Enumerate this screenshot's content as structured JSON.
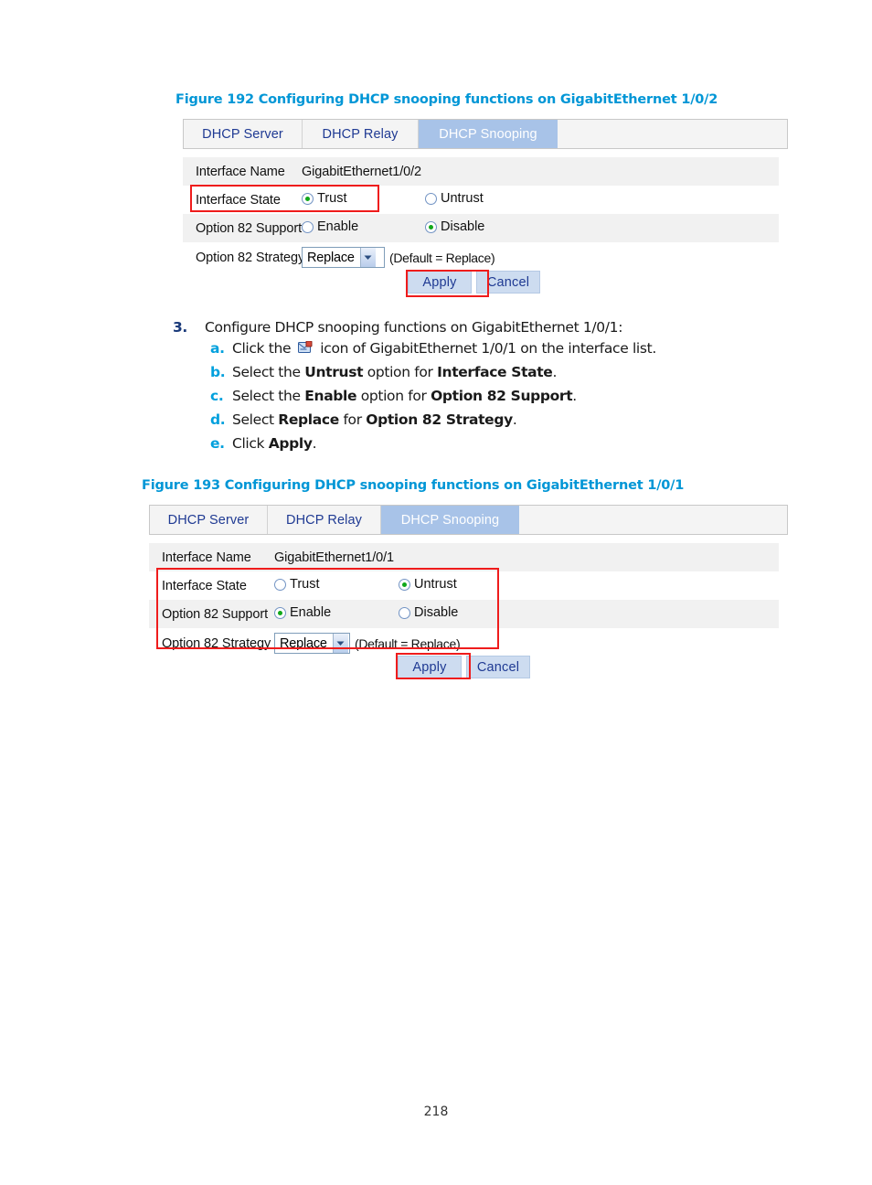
{
  "page": {
    "number": "218"
  },
  "figure192": {
    "caption": "Figure 192 Configuring DHCP snooping functions on GigabitEthernet 1/0/2",
    "tabs": [
      {
        "label": "DHCP Server",
        "active": false
      },
      {
        "label": "DHCP Relay",
        "active": false
      },
      {
        "label": "DHCP Snooping",
        "active": true
      }
    ],
    "rows": {
      "interface_name_label": "Interface Name",
      "interface_name_value": "GigabitEthernet1/0/2",
      "interface_state_label": "Interface State",
      "interface_state_trust": "Trust",
      "interface_state_untrust": "Untrust",
      "interface_state_selected": "Trust",
      "option82_support_label": "Option 82 Support",
      "option82_enable": "Enable",
      "option82_disable": "Disable",
      "option82_support_selected": "Disable",
      "option82_strategy_label": "Option 82 Strategy",
      "option82_strategy_value": "Replace",
      "option82_strategy_hint": "(Default = Replace)"
    },
    "buttons": {
      "apply": "Apply",
      "cancel": "Cancel"
    }
  },
  "steps": {
    "step3": {
      "number": "3.",
      "text": "Configure DHCP snooping functions on GigabitEthernet 1/0/1:"
    },
    "substeps": [
      {
        "letter": "a.",
        "pre": "Click the ",
        "icon": "configure-interface-icon",
        "post": " icon of GigabitEthernet 1/0/1 on the interface list."
      },
      {
        "letter": "b.",
        "pre": "Select the ",
        "bold1": "Untrust",
        "mid": " option for ",
        "bold2": "Interface State",
        "post": "."
      },
      {
        "letter": "c.",
        "pre": "Select the ",
        "bold1": "Enable",
        "mid": " option for ",
        "bold2": "Option 82 Support",
        "post": "."
      },
      {
        "letter": "d.",
        "pre": "Select ",
        "bold1": "Replace",
        "mid": " for ",
        "bold2": "Option 82 Strategy",
        "post": "."
      },
      {
        "letter": "e.",
        "pre": "Click ",
        "bold1": "Apply",
        "mid": "",
        "bold2": "",
        "post": "."
      }
    ]
  },
  "figure193": {
    "caption": "Figure 193 Configuring DHCP snooping functions on GigabitEthernet 1/0/1",
    "tabs": [
      {
        "label": "DHCP Server",
        "active": false
      },
      {
        "label": "DHCP Relay",
        "active": false
      },
      {
        "label": "DHCP Snooping",
        "active": true
      }
    ],
    "rows": {
      "interface_name_label": "Interface Name",
      "interface_name_value": "GigabitEthernet1/0/1",
      "interface_state_label": "Interface State",
      "interface_state_trust": "Trust",
      "interface_state_untrust": "Untrust",
      "interface_state_selected": "Untrust",
      "option82_support_label": "Option 82 Support",
      "option82_enable": "Enable",
      "option82_disable": "Disable",
      "option82_support_selected": "Enable",
      "option82_strategy_label": "Option 82 Strategy",
      "option82_strategy_value": "Replace",
      "option82_strategy_hint": "(Default = Replace)"
    },
    "buttons": {
      "apply": "Apply",
      "cancel": "Cancel"
    }
  },
  "colors": {
    "caption_blue": "#0096d6",
    "active_tab_bg": "#a8c3e8",
    "tab_text": "#1f3a93",
    "annotation_red": "#ef1c1c",
    "radio_dot_green": "#10a81a",
    "button_bg": "#cddcf0",
    "substep_letter_blue": "#00a0dd"
  }
}
